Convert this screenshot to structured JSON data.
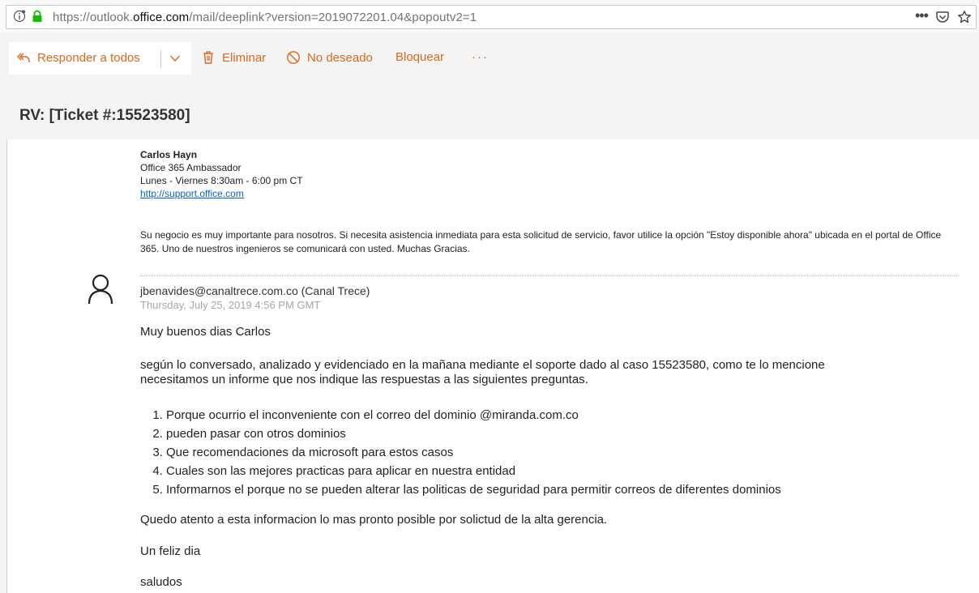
{
  "browser": {
    "url_prefix": "https://outlook.",
    "url_domain": "office.com",
    "url_suffix": "/mail/deeplink?version=2019072201.04&popoutv2=1",
    "more_label": "•••"
  },
  "toolbar": {
    "reply_all_label": "Responder a todos",
    "delete_label": "Eliminar",
    "junk_label": "No deseado",
    "block_label": "Bloquear",
    "more_label": "···"
  },
  "subject": "RV: [Ticket #:15523580]",
  "signature": {
    "name": "Carlos Hayn",
    "role": "Office 365 Ambassador",
    "hours": "Lunes - Viernes 8:30am - 6:00 pm CT",
    "link": "http://support.office.com"
  },
  "notice": "Su negocio es muy importante para nosotros. Si necesita asistencia inmediata para esta solicitud de servicio, favor utilice la opción \"Estoy disponible ahora\" ubicada en el portal de Office 365. Uno de nuestros ingenieros se comunicará con usted. Muchas Gracias.",
  "message": {
    "sender": "jbenavides@canaltrece.com.co (Canal Trece)",
    "date": "Thursday, July 25, 2019 4:56 PM GMT",
    "greeting": "Muy buenos dias Carlos",
    "para1_line1": "según lo conversado, analizado y evidenciado en la mañana mediante el soporte dado al caso 15523580, como te lo mencione",
    "para1_line2": "necesitamos un informe que nos indique las respuestas a las siguientes preguntas.",
    "questions": [
      "Porque ocurrio el inconveniente con el correo del dominio @miranda.com.co",
      "pueden pasar con otros dominios",
      "Que recomendaciones da microsoft para estos casos",
      "Cuales son las mejores practicas para aplicar en nuestra entidad",
      "Informarnos el porque no se pueden alterar las politicas de seguridad para permitir correos de diferentes dominios"
    ],
    "closing": "Quedo atento a esta informacion lo mas pronto posible por solictud de la alta gerencia.",
    "farewell": "Un feliz dia",
    "regards": "saludos"
  },
  "colors": {
    "accent": "#d8691c",
    "link": "#0563c1",
    "lock": "#12bc00"
  }
}
